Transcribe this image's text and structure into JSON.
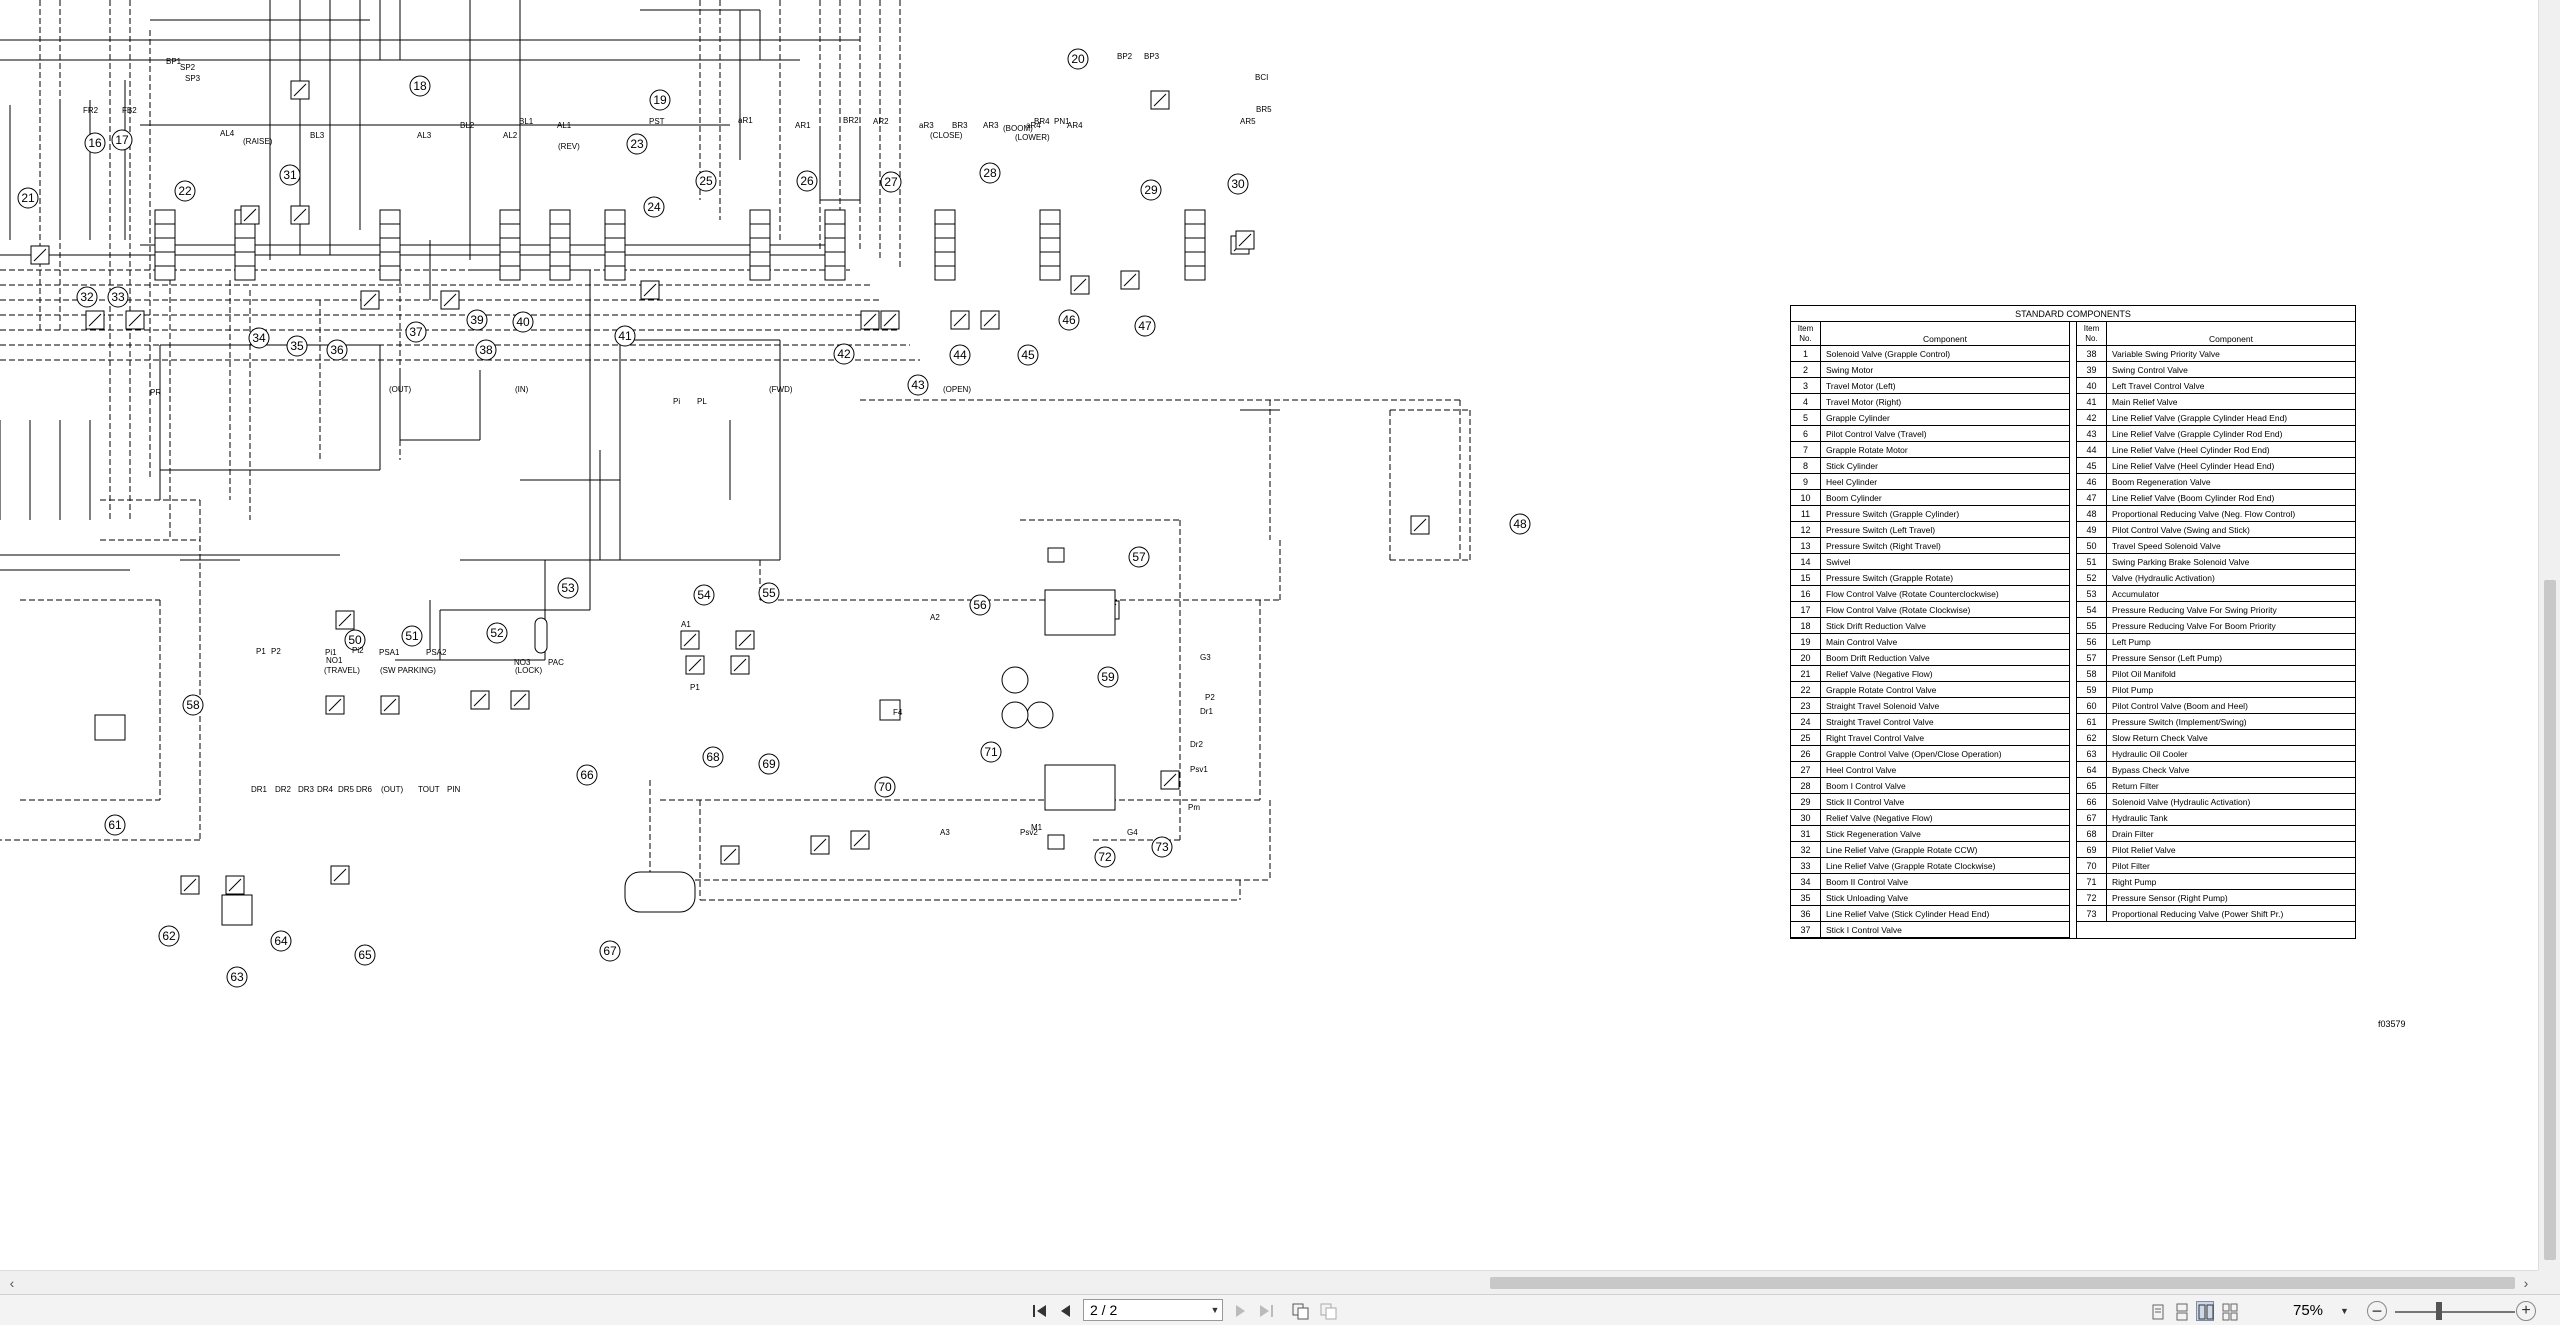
{
  "document": {
    "table": {
      "title": "STANDARD COMPONENTS",
      "header_item": "Item No.",
      "header_component": "Component",
      "left_rows": [
        {
          "no": "1",
          "name": "Solenoid Valve (Grapple Control)"
        },
        {
          "no": "2",
          "name": "Swing Motor"
        },
        {
          "no": "3",
          "name": "Travel Motor (Left)"
        },
        {
          "no": "4",
          "name": "Travel Motor (Right)"
        },
        {
          "no": "5",
          "name": "Grapple Cylinder"
        },
        {
          "no": "6",
          "name": "Pilot Control Valve (Travel)"
        },
        {
          "no": "7",
          "name": "Grapple Rotate Motor"
        },
        {
          "no": "8",
          "name": "Stick Cylinder"
        },
        {
          "no": "9",
          "name": "Heel Cylinder"
        },
        {
          "no": "10",
          "name": "Boom Cylinder"
        },
        {
          "no": "11",
          "name": "Pressure Switch (Grapple Cylinder)"
        },
        {
          "no": "12",
          "name": "Pressure Switch (Left Travel)"
        },
        {
          "no": "13",
          "name": "Pressure Switch (Right Travel)"
        },
        {
          "no": "14",
          "name": "Swivel"
        },
        {
          "no": "15",
          "name": "Pressure Switch (Grapple Rotate)"
        },
        {
          "no": "16",
          "name": "Flow Control Valve (Rotate Counterclockwise)"
        },
        {
          "no": "17",
          "name": "Flow Control Valve (Rotate Clockwise)"
        },
        {
          "no": "18",
          "name": "Stick Drift Reduction Valve"
        },
        {
          "no": "19",
          "name": "Main Control Valve"
        },
        {
          "no": "20",
          "name": "Boom Drift Reduction Valve"
        },
        {
          "no": "21",
          "name": "Relief Valve (Negative Flow)"
        },
        {
          "no": "22",
          "name": "Grapple Rotate Control Valve"
        },
        {
          "no": "23",
          "name": "Straight Travel Solenoid Valve"
        },
        {
          "no": "24",
          "name": "Straight Travel Control Valve"
        },
        {
          "no": "25",
          "name": "Right Travel Control Valve"
        },
        {
          "no": "26",
          "name": "Grapple Control Valve (Open/Close Operation)"
        },
        {
          "no": "27",
          "name": "Heel Control Valve"
        },
        {
          "no": "28",
          "name": "Boom I Control Valve"
        },
        {
          "no": "29",
          "name": "Stick II Control Valve"
        },
        {
          "no": "30",
          "name": "Relief Valve (Negative Flow)"
        },
        {
          "no": "31",
          "name": "Stick Regeneration Valve"
        },
        {
          "no": "32",
          "name": "Line Relief Valve (Grapple Rotate CCW)"
        },
        {
          "no": "33",
          "name": "Line Relief Valve (Grapple Rotate Clockwise)"
        },
        {
          "no": "34",
          "name": "Boom II Control Valve"
        },
        {
          "no": "35",
          "name": "Stick Unloading Valve"
        },
        {
          "no": "36",
          "name": "Line Relief Valve (Stick Cylinder Head End)"
        },
        {
          "no": "37",
          "name": "Stick I Control Valve"
        }
      ],
      "right_rows": [
        {
          "no": "38",
          "name": "Variable Swing Priority Valve"
        },
        {
          "no": "39",
          "name": "Swing Control Valve"
        },
        {
          "no": "40",
          "name": "Left Travel Control Valve"
        },
        {
          "no": "41",
          "name": "Main Relief Valve"
        },
        {
          "no": "42",
          "name": "Line Relief Valve (Grapple Cylinder Head End)"
        },
        {
          "no": "43",
          "name": "Line Relief Valve (Grapple Cylinder Rod End)"
        },
        {
          "no": "44",
          "name": "Line Relief Valve (Heel Cylinder Rod End)"
        },
        {
          "no": "45",
          "name": "Line Relief Valve (Heel Cylinder Head End)"
        },
        {
          "no": "46",
          "name": "Boom Regeneration Valve"
        },
        {
          "no": "47",
          "name": "Line Relief Valve (Boom Cylinder Rod End)"
        },
        {
          "no": "48",
          "name": "Proportional Reducing Valve (Neg. Flow Control)"
        },
        {
          "no": "49",
          "name": "Pilot Control Valve (Swing and Stick)"
        },
        {
          "no": "50",
          "name": "Travel Speed Solenoid Valve"
        },
        {
          "no": "51",
          "name": "Swing Parking Brake Solenoid Valve"
        },
        {
          "no": "52",
          "name": "Valve (Hydraulic Activation)"
        },
        {
          "no": "53",
          "name": "Accumulator"
        },
        {
          "no": "54",
          "name": "Pressure Reducing Valve For Swing Priority"
        },
        {
          "no": "55",
          "name": "Pressure Reducing Valve For Boom Priority"
        },
        {
          "no": "56",
          "name": "Left Pump"
        },
        {
          "no": "57",
          "name": "Pressure Sensor (Left Pump)"
        },
        {
          "no": "58",
          "name": " Pilot Oil Manifold"
        },
        {
          "no": "59",
          "name": "Pilot Pump"
        },
        {
          "no": "60",
          "name": "Pilot Control Valve (Boom and Heel)"
        },
        {
          "no": "61",
          "name": "Pressure Switch (Implement/Swing)"
        },
        {
          "no": "62",
          "name": "Slow Return Check Valve"
        },
        {
          "no": "63",
          "name": "Hydraulic Oil Cooler"
        },
        {
          "no": "64",
          "name": "Bypass Check Valve"
        },
        {
          "no": "65",
          "name": "Return Filter"
        },
        {
          "no": "66",
          "name": "Solenoid Valve (Hydraulic Activation)"
        },
        {
          "no": "67",
          "name": "Hydraulic Tank"
        },
        {
          "no": "68",
          "name": "Drain Filter"
        },
        {
          "no": "69",
          "name": "Pilot Relief Valve"
        },
        {
          "no": "70",
          "name": "Pilot Filter"
        },
        {
          "no": "71",
          "name": "Right Pump"
        },
        {
          "no": "72",
          "name": "Pressure Sensor (Right Pump)"
        },
        {
          "no": "73",
          "name": "Proportional Reducing Valve (Power Shift Pr.)"
        }
      ]
    },
    "drawing_number": "f03579",
    "callouts": [
      "16",
      "17",
      "18",
      "19",
      "20",
      "21",
      "22",
      "23",
      "24",
      "25",
      "26",
      "27",
      "28",
      "29",
      "30",
      "31",
      "32",
      "33",
      "34",
      "35",
      "36",
      "37",
      "38",
      "39",
      "40",
      "41",
      "42",
      "43",
      "44",
      "45",
      "46",
      "47",
      "48",
      "50",
      "51",
      "52",
      "53",
      "54",
      "55",
      "56",
      "57",
      "58",
      "59",
      "61",
      "62",
      "63",
      "64",
      "65",
      "66",
      "67",
      "68",
      "69",
      "70",
      "71",
      "72",
      "73"
    ],
    "port_labels": [
      "FR2",
      "FB2",
      "SP3",
      "BP1",
      "SP2",
      "BL3",
      "BL2",
      "BL1",
      "AL3",
      "AL2",
      "AL1",
      "AL4",
      "PST",
      "aR1",
      "AR1",
      "BR2",
      "AR2",
      "aR3",
      "BR3",
      "AR3",
      "aR4",
      "BR4",
      "AR4",
      "PN1",
      "BP2",
      "BP3",
      "BCI",
      "BR5",
      "AR5",
      "(RAISE)",
      "(BOOM)",
      "(LOWER)",
      "(CLOSE)",
      "(REV)",
      "(FWD)",
      "(OUT)",
      "(IN)",
      "(OPEN)",
      "DR1",
      "DR2",
      "DR3",
      "DR4",
      "DR5",
      "DR6",
      "(OUT)",
      "TOUT",
      "PIN",
      "P1",
      "P2",
      "Pi1",
      "Pi2",
      "PSA1",
      "PSA2",
      "NO1",
      "NO3",
      "PAC",
      "(TRAVEL)",
      "(SW PARKING)",
      "(LOCK)",
      "A1",
      "A2",
      "A3",
      "P1",
      "P2",
      "Dr1",
      "Dr2",
      "Psv1",
      "Psv2",
      "M1",
      "G3",
      "G4",
      "Pm",
      "Pi",
      "PL",
      "PR",
      "F4",
      "M"
    ]
  },
  "toolbar": {
    "page_field_value": "2 / 2",
    "zoom_level": "75%",
    "first_page_icon": "first-page-icon",
    "prev_page_icon": "prev-page-icon",
    "next_page_icon": "next-page-icon",
    "last_page_icon": "last-page-icon"
  }
}
